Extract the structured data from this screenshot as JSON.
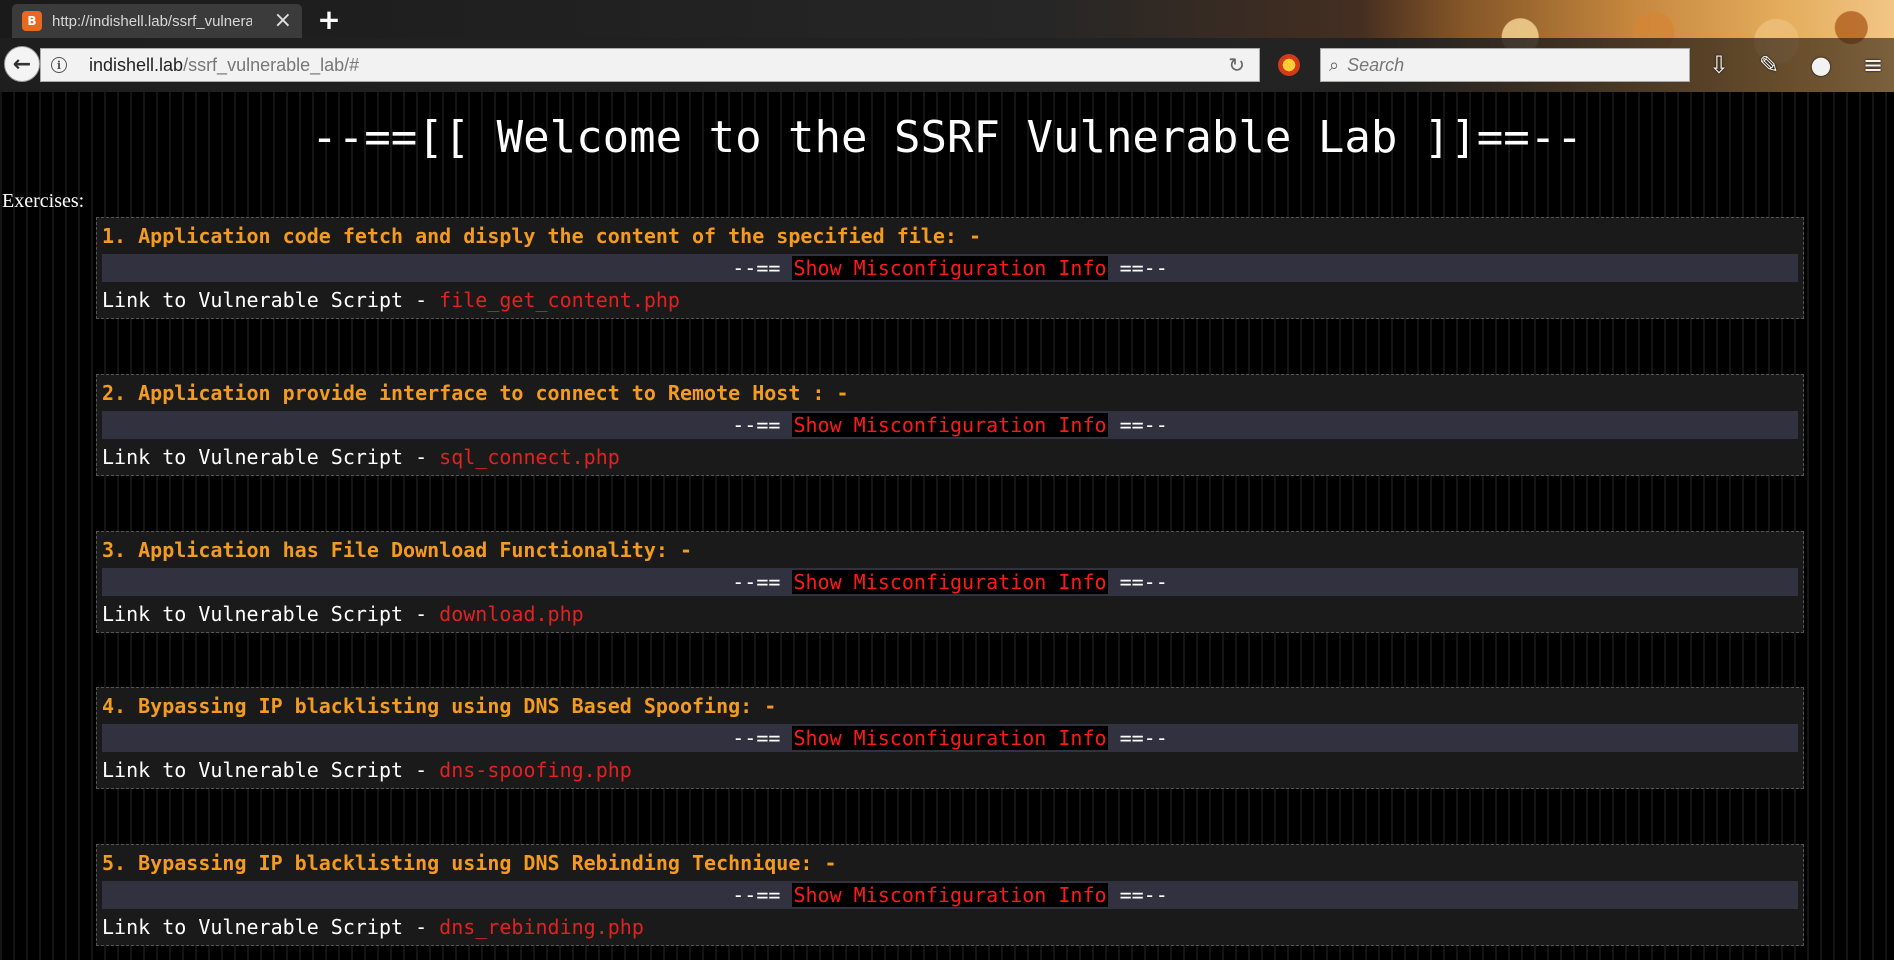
{
  "browser": {
    "tab_title": "http://indishell.lab/ssrf_vulnerable_lab/#",
    "tab_favicon_text": "B",
    "url_host": "indishell.lab",
    "url_path": "/ssrf_vulnerable_lab/#",
    "search_placeholder": "Search",
    "icons": [
      "back-arrow-icon",
      "info-icon",
      "reload-icon",
      "addon-icon",
      "search-icon",
      "download-icon",
      "tools-icon",
      "extension-icon",
      "menu-icon"
    ]
  },
  "page": {
    "title": "--==[[ Welcome to the SSRF Vulnerable Lab ]]==--",
    "exercises_label": "Exercises:",
    "misconfig_prefix": "--== ",
    "misconfig_link": "Show Misconfiguration Info",
    "misconfig_suffix": " ==--",
    "script_prefix": "Link to Vulnerable Script - ",
    "accent_color": "#f39a21",
    "link_color": "#e02222",
    "exercises": [
      {
        "heading": "1. Application code fetch and disply the content of the specified file: -",
        "script": "file_get_content.php"
      },
      {
        "heading": "2. Application provide interface to connect to Remote Host : -",
        "script": "sql_connect.php"
      },
      {
        "heading": "3. Application has File Download Functionality: -",
        "script": "download.php"
      },
      {
        "heading": "4. Bypassing IP blacklisting using DNS Based Spoofing: -",
        "script": "dns-spoofing.php"
      },
      {
        "heading": "5. Bypassing IP blacklisting using DNS Rebinding Technique: -",
        "script": "dns_rebinding.php"
      }
    ]
  }
}
